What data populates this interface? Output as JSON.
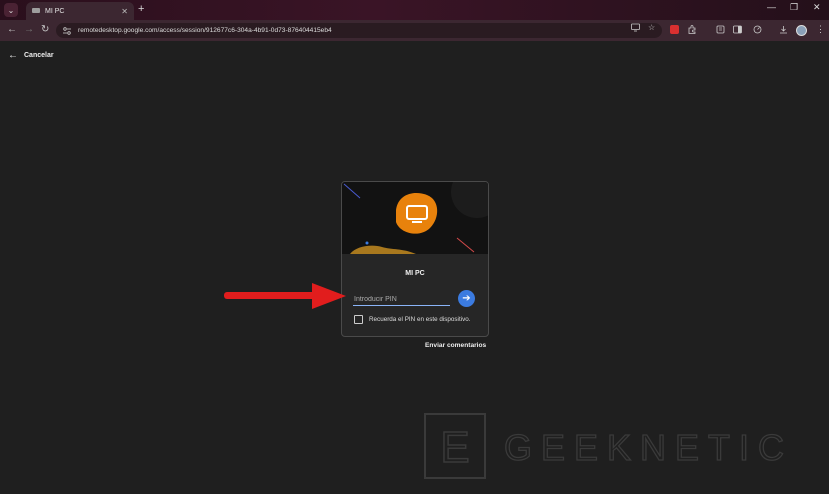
{
  "browser": {
    "tab": {
      "title": "MI PC",
      "close": "✕"
    },
    "new_tab": "+",
    "window_controls": {
      "minimize": "—",
      "maximize": "❐",
      "close": "✕"
    },
    "nav": {
      "back": "←",
      "forward": "→",
      "reload": "↻"
    },
    "url": "remotedesktop.google.com/access/session/912677c6-304a-4b91-0d73-876404415eb4"
  },
  "page": {
    "cancel_label": "Cancelar",
    "card": {
      "title": "MI PC",
      "pin_placeholder": "Introducir PIN",
      "submit_icon": "➔",
      "remember_label": "Recuerda el PIN en este dispositivo."
    },
    "feedback_label": "Enviar comentarios"
  },
  "watermark": {
    "text": "GEEKNETIC",
    "logo_letter": "E"
  },
  "colors": {
    "accent_blue": "#3b7be0",
    "monitor_orange": "#e8820c",
    "annotation_red": "#e11d1d",
    "titlebar": "#3c2731"
  }
}
